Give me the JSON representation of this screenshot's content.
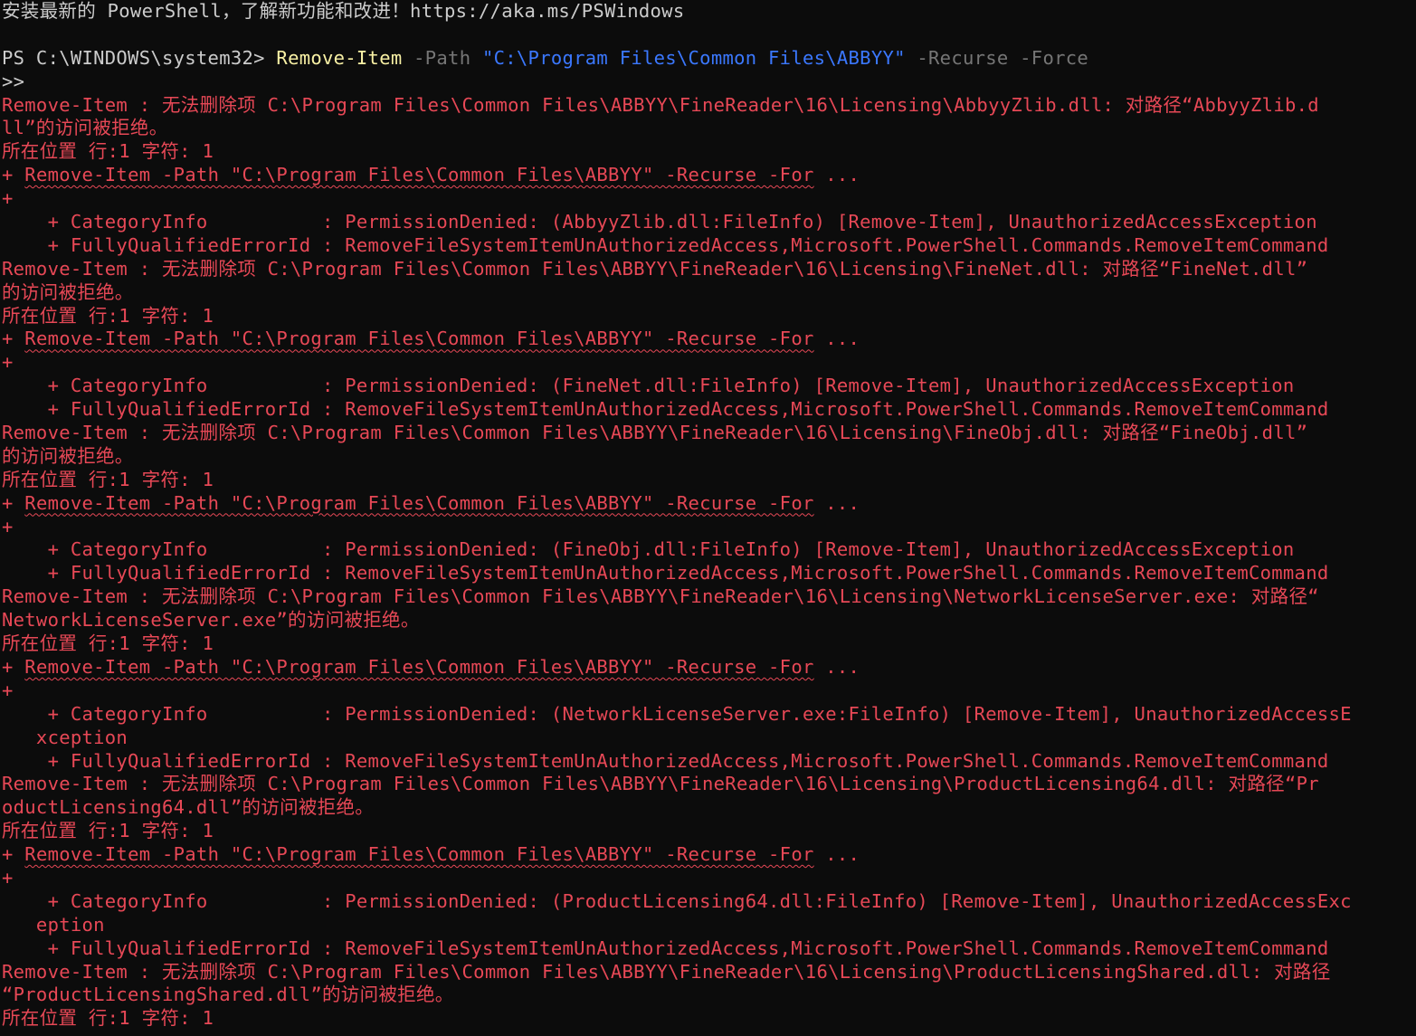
{
  "banner": "安装最新的 PowerShell，了解新功能和改进！https://aka.ms/PSWindows",
  "prompt": {
    "prefix": "PS C:\\WINDOWS\\system32> ",
    "command": "Remove-Item",
    "param_path": " -Path ",
    "path_value": "\"C:\\Program Files\\Common Files\\ABBYY\"",
    "param_rest": " -Recurse -Force",
    "continuation": ">>"
  },
  "errors": [
    {
      "message": [
        "Remove-Item : 无法删除项 C:\\Program Files\\Common Files\\ABBYY\\FineReader\\16\\Licensing\\AbbyyZlib.dll: 对路径“AbbyyZlib.d",
        "ll”的访问被拒绝。"
      ],
      "location": "所在位置 行:1 字符: 1",
      "snippet_prefix": "+ ",
      "snippet": "Remove-Item -Path \"C:\\Program Files\\Common Files\\ABBYY\" -Recurse -For",
      "snippet_suffix": " ...",
      "plus": "+",
      "category": [
        "    + CategoryInfo          : PermissionDenied: (AbbyyZlib.dll:FileInfo) [Remove-Item], UnauthorizedAccessException"
      ],
      "fqid": "    + FullyQualifiedErrorId : RemoveFileSystemItemUnAuthorizedAccess,Microsoft.PowerShell.Commands.RemoveItemCommand"
    },
    {
      "message": [
        "Remove-Item : 无法删除项 C:\\Program Files\\Common Files\\ABBYY\\FineReader\\16\\Licensing\\FineNet.dll: 对路径“FineNet.dll”",
        "的访问被拒绝。"
      ],
      "location": "所在位置 行:1 字符: 1",
      "snippet_prefix": "+ ",
      "snippet": "Remove-Item -Path \"C:\\Program Files\\Common Files\\ABBYY\" -Recurse -For",
      "snippet_suffix": " ...",
      "plus": "+",
      "category": [
        "    + CategoryInfo          : PermissionDenied: (FineNet.dll:FileInfo) [Remove-Item], UnauthorizedAccessException"
      ],
      "fqid": "    + FullyQualifiedErrorId : RemoveFileSystemItemUnAuthorizedAccess,Microsoft.PowerShell.Commands.RemoveItemCommand"
    },
    {
      "message": [
        "Remove-Item : 无法删除项 C:\\Program Files\\Common Files\\ABBYY\\FineReader\\16\\Licensing\\FineObj.dll: 对路径“FineObj.dll”",
        "的访问被拒绝。"
      ],
      "location": "所在位置 行:1 字符: 1",
      "snippet_prefix": "+ ",
      "snippet": "Remove-Item -Path \"C:\\Program Files\\Common Files\\ABBYY\" -Recurse -For",
      "snippet_suffix": " ...",
      "plus": "+",
      "category": [
        "    + CategoryInfo          : PermissionDenied: (FineObj.dll:FileInfo) [Remove-Item], UnauthorizedAccessException"
      ],
      "fqid": "    + FullyQualifiedErrorId : RemoveFileSystemItemUnAuthorizedAccess,Microsoft.PowerShell.Commands.RemoveItemCommand"
    },
    {
      "message": [
        "Remove-Item : 无法删除项 C:\\Program Files\\Common Files\\ABBYY\\FineReader\\16\\Licensing\\NetworkLicenseServer.exe: 对路径“",
        "NetworkLicenseServer.exe”的访问被拒绝。"
      ],
      "location": "所在位置 行:1 字符: 1",
      "snippet_prefix": "+ ",
      "snippet": "Remove-Item -Path \"C:\\Program Files\\Common Files\\ABBYY\" -Recurse -For",
      "snippet_suffix": " ...",
      "plus": "+",
      "category": [
        "    + CategoryInfo          : PermissionDenied: (NetworkLicenseServer.exe:FileInfo) [Remove-Item], UnauthorizedAccessE",
        "   xception"
      ],
      "fqid": "    + FullyQualifiedErrorId : RemoveFileSystemItemUnAuthorizedAccess,Microsoft.PowerShell.Commands.RemoveItemCommand"
    },
    {
      "message": [
        "Remove-Item : 无法删除项 C:\\Program Files\\Common Files\\ABBYY\\FineReader\\16\\Licensing\\ProductLicensing64.dll: 对路径“Pr",
        "oductLicensing64.dll”的访问被拒绝。"
      ],
      "location": "所在位置 行:1 字符: 1",
      "snippet_prefix": "+ ",
      "snippet": "Remove-Item -Path \"C:\\Program Files\\Common Files\\ABBYY\" -Recurse -For",
      "snippet_suffix": " ...",
      "plus": "+",
      "category": [
        "    + CategoryInfo          : PermissionDenied: (ProductLicensing64.dll:FileInfo) [Remove-Item], UnauthorizedAccessExc",
        "   eption"
      ],
      "fqid": "    + FullyQualifiedErrorId : RemoveFileSystemItemUnAuthorizedAccess,Microsoft.PowerShell.Commands.RemoveItemCommand"
    },
    {
      "message": [
        "Remove-Item : 无法删除项 C:\\Program Files\\Common Files\\ABBYY\\FineReader\\16\\Licensing\\ProductLicensingShared.dll: 对路径",
        "“ProductLicensingShared.dll”的访问被拒绝。"
      ],
      "location": "所在位置 行:1 字符: 1"
    }
  ],
  "colors": {
    "background": "#0c0c0c",
    "foreground": "#cccccc",
    "error": "#e74856",
    "command": "#f9f1a5",
    "parameter": "#767676",
    "string": "#3b78ff"
  }
}
